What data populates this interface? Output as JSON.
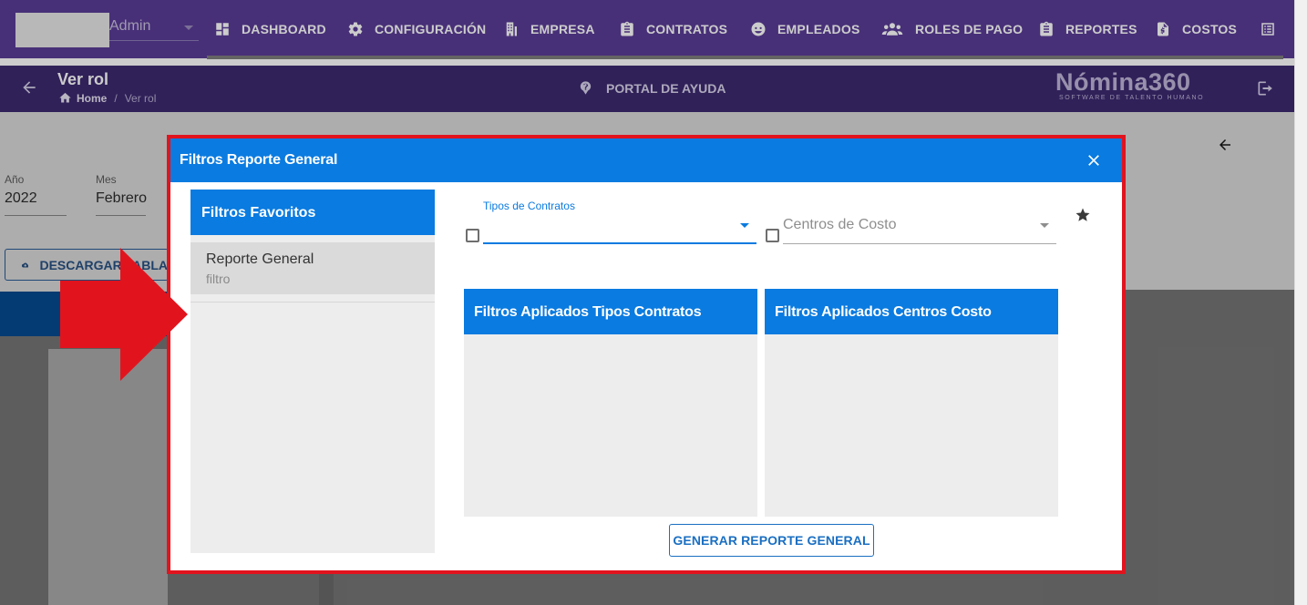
{
  "topbar": {
    "user_name": "Admin",
    "nav": [
      {
        "label": "DASHBOARD",
        "icon": "dashboard-icon"
      },
      {
        "label": "CONFIGURACIÓN",
        "icon": "gear-icon"
      },
      {
        "label": "EMPRESA",
        "icon": "building-icon"
      },
      {
        "label": "CONTRATOS",
        "icon": "clipboard-icon"
      },
      {
        "label": "EMPLEADOS",
        "icon": "face-icon"
      },
      {
        "label": "ROLES DE PAGO",
        "icon": "people-icon"
      },
      {
        "label": "REPORTES",
        "icon": "clipboard-icon"
      },
      {
        "label": "COSTOS",
        "icon": "invoice-icon"
      }
    ]
  },
  "subbar": {
    "title": "Ver rol",
    "breadcrumb_home": "Home",
    "breadcrumb_separator": "/",
    "breadcrumb_current": "Ver rol",
    "help_label": "PORTAL DE AYUDA",
    "brand_name": "Nómina360",
    "brand_tagline": "SOFTWARE DE TALENTO HUMANO"
  },
  "background": {
    "year_label": "Año",
    "year_value": "2022",
    "month_label": "Mes",
    "month_value": "Febrero",
    "download_label": "DESCARGAR TABLA"
  },
  "dialog": {
    "title": "Filtros Reporte General",
    "favorites": {
      "header": "Filtros Favoritos",
      "items": [
        {
          "title": "Reporte General",
          "subtitle": "filtro"
        }
      ]
    },
    "contract_types_label": "Tipos de Contratos",
    "contract_types_value": "",
    "cost_centers_placeholder": "Centros de Costo",
    "applied_contracts_header": "Filtros Aplicados Tipos Contratos",
    "applied_costs_header": "Filtros Aplicados Centros Costo",
    "generate_label": "GENERAR REPORTE GENERAL"
  },
  "colors": {
    "nav_purple": "#5a3c97",
    "dialog_blue": "#0a7be0",
    "highlight_red": "#e1141e"
  }
}
